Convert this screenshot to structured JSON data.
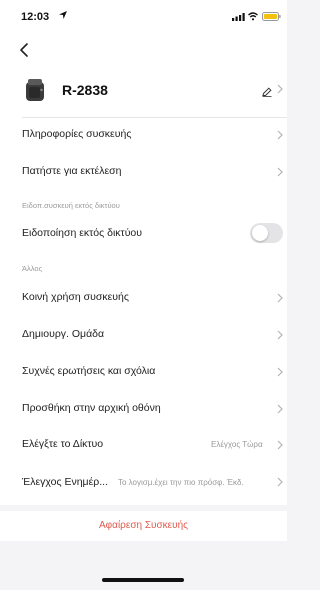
{
  "status_bar": {
    "time": "12:03"
  },
  "header": {
    "device_name": "R-2838"
  },
  "rows": {
    "device_info": "Πληροφορίες συσκευής",
    "tap_to_run": "Πατήστε για εκτέλεση",
    "offline_section": "Ειδοπ.συσκευή εκτός δικτύου",
    "offline_notification": "Ειδοποίηση εκτός δικτύου",
    "other_section": "Άλλος",
    "share_device": "Κοινή χρήση συσκευής",
    "create_group": "Δημιουργ. Ομάδα",
    "faq": "Συχνές ερωτήσεις και σχόλια",
    "add_to_home": "Προσθήκη στην αρχική οθόνη",
    "check_network": "Ελέγξτε το Δίκτυο",
    "check_network_value": "Ελέγχος Τώρα",
    "check_update": "Έλεγχος Ενημέρ...",
    "check_update_value": "Το λογισμ.έχει την πιο πρόσφ. Έκδ."
  },
  "toggle": {
    "offline_notification_on": false
  },
  "actions": {
    "remove_device": "Αφαίρεση Συσκευής"
  },
  "colors": {
    "accent_red": "#e05a4e",
    "background": "#f4f4f6",
    "card": "#ffffff",
    "muted_text": "#9b9b9b"
  },
  "icons": {
    "back": "chevron-left-icon",
    "location": "location-arrow-icon",
    "signal": "cellular-signal-icon",
    "wifi": "wifi-icon",
    "battery": "battery-icon",
    "device": "air-fryer-icon",
    "edit": "pencil-icon",
    "row_chevron": "chevron-right-icon"
  }
}
